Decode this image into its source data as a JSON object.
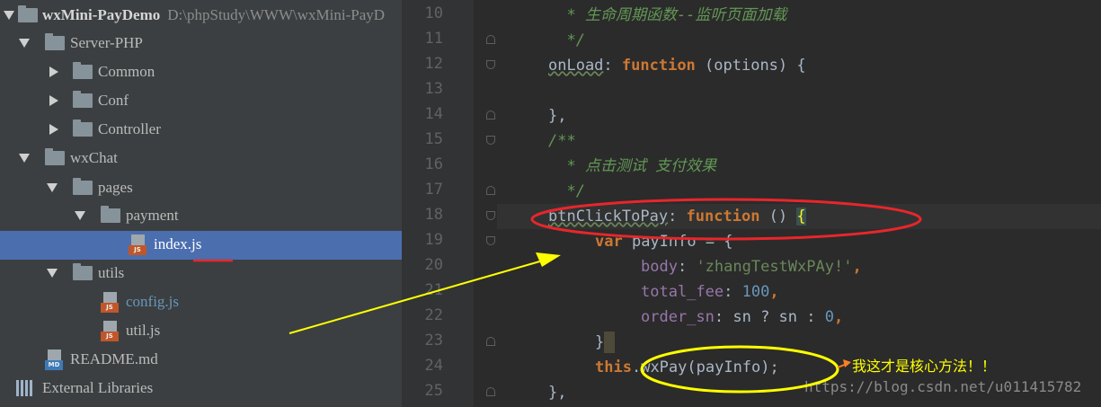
{
  "project": {
    "name": "wxMini-PayDemo",
    "path": "D:\\phpStudy\\WWW\\wxMini-PayD"
  },
  "tree": [
    {
      "label": "Server-PHP",
      "kind": "folder",
      "state": "expanded"
    },
    {
      "label": "Common",
      "kind": "folder",
      "state": "collapsed"
    },
    {
      "label": "Conf",
      "kind": "folder",
      "state": "collapsed"
    },
    {
      "label": "Controller",
      "kind": "folder",
      "state": "collapsed"
    },
    {
      "label": "wxChat",
      "kind": "folder",
      "state": "expanded"
    },
    {
      "label": "pages",
      "kind": "folder",
      "state": "expanded"
    },
    {
      "label": "payment",
      "kind": "folder",
      "state": "expanded"
    },
    {
      "label": "index.js",
      "kind": "file",
      "tag": "JS",
      "selected": true
    },
    {
      "label": "utils",
      "kind": "folder",
      "state": "expanded"
    },
    {
      "label": "config.js",
      "kind": "file",
      "tag": "JS"
    },
    {
      "label": "util.js",
      "kind": "file",
      "tag": "JS"
    },
    {
      "label": "README.md",
      "kind": "file",
      "tag": "MD"
    },
    {
      "label": "External Libraries",
      "kind": "libraries"
    }
  ],
  "editor": {
    "line_numbers": [
      "10",
      "11",
      "12",
      "13",
      "14",
      "15",
      "16",
      "17",
      "18",
      "19",
      "20",
      "21",
      "22",
      "23",
      "24",
      "25"
    ],
    "code": {
      "l10": "  * 生命周期函数--监听页面加载",
      "l11": "  */",
      "l12_name": "onLoad",
      "l12_colon": ": ",
      "l12_kw": "function",
      "l12_rest": " (options) {",
      "l14": "},",
      "l15": "/**",
      "l16": "  * 点击测试 支付效果",
      "l17": "  */",
      "l18_name": "btnClickToPay",
      "l18_colon": ": ",
      "l18_kw": "function",
      "l18_rest": " () ",
      "l18_brace": "{",
      "l19_kw": "var",
      "l19_rest": " payInfo = {",
      "l20_prop": "body",
      "l20_colon": ": ",
      "l20_str": "'zhangTestWxPAy!'",
      "l20_end": ",",
      "l21_prop": "total_fee",
      "l21_colon": ": ",
      "l21_num": "100",
      "l21_end": ",",
      "l22_prop": "order_sn",
      "l22_mid": ": sn ? sn : ",
      "l22_num": "0",
      "l22_end": ",",
      "l23": "}",
      "l24_kw": "this",
      "l24_dot": ".",
      "l24_fn": "wxPay",
      "l24_rest": "(payInfo);",
      "l25": "},"
    }
  },
  "annotation_text": "我这才是核心方法！！",
  "watermark": "https://blog.csdn.net/u011415782",
  "colors": {
    "circle_red": "#e8262b",
    "circle_yellow": "#ffff00",
    "arrow_yellow": "#ffff00",
    "arrow_orange": "#ff7f27",
    "underline_red": "#e8262b"
  }
}
